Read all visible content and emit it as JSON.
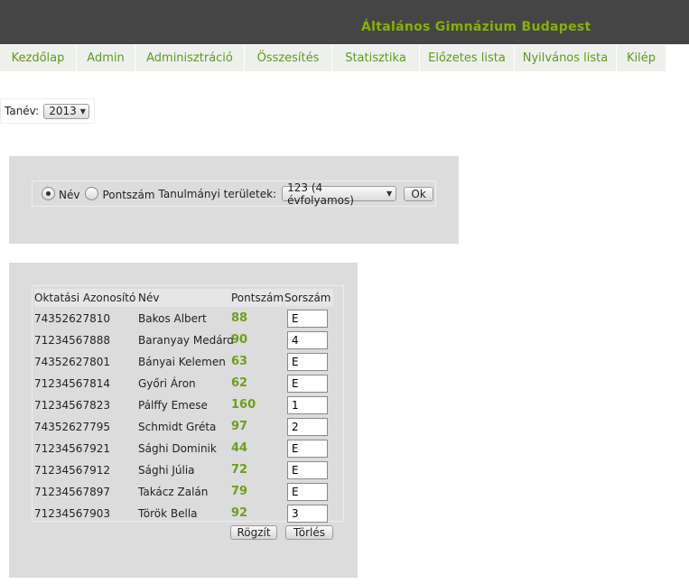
{
  "header": {
    "title": "Általános Gimnázium Budapest"
  },
  "nav": {
    "items": [
      {
        "label": "Kezdőlap",
        "w": 84
      },
      {
        "label": "Admin",
        "w": 64
      },
      {
        "label": "Adminisztráció",
        "w": 120
      },
      {
        "label": "Összesítés",
        "w": 96
      },
      {
        "label": "Statisztika",
        "w": 96
      },
      {
        "label": "Előzetes lista",
        "w": 104
      },
      {
        "label": "Nyilvános lista",
        "w": 112
      },
      {
        "label": "Kilép",
        "w": 54
      }
    ]
  },
  "year": {
    "label": "Tanév:",
    "value": "2013"
  },
  "filter": {
    "radio_name": "Név",
    "radio_score": "Pontszám",
    "selected": "name",
    "area_label": "Tanulmányi területek:",
    "area_value": "123 (4 évfolyamos)",
    "ok_label": "Ok"
  },
  "table": {
    "headers": [
      "Oktatási Azonosító",
      "Név",
      "Pontszám",
      "Sorszám"
    ],
    "rows": [
      {
        "id": "74352627810",
        "name": "Bakos Albert",
        "score": "88",
        "rank": "E"
      },
      {
        "id": "71234567888",
        "name": "Baranyay Medárd",
        "score": "90",
        "rank": "4"
      },
      {
        "id": "74352627801",
        "name": "Bányai Kelemen",
        "score": "63",
        "rank": "E"
      },
      {
        "id": "71234567814",
        "name": "Győri Áron",
        "score": "62",
        "rank": "E"
      },
      {
        "id": "71234567823",
        "name": "Pálffy Emese",
        "score": "160",
        "rank": "1"
      },
      {
        "id": "74352627795",
        "name": "Schmidt Gréta",
        "score": "97",
        "rank": "2"
      },
      {
        "id": "71234567921",
        "name": "Sághi Dominik",
        "score": "44",
        "rank": "E"
      },
      {
        "id": "71234567912",
        "name": "Sághi Júlia",
        "score": "72",
        "rank": "E"
      },
      {
        "id": "71234567897",
        "name": "Takácz Zalán",
        "score": "79",
        "rank": "E"
      },
      {
        "id": "71234567903",
        "name": "Török Bella",
        "score": "92",
        "rank": "3"
      }
    ],
    "save_label": "Rögzít",
    "delete_label": "Törlés"
  },
  "colors": {
    "header_bg": "#454545",
    "accent": "#86b300",
    "nav_bg": "#eef0ec",
    "panel_bg": "#dcdcdc"
  }
}
